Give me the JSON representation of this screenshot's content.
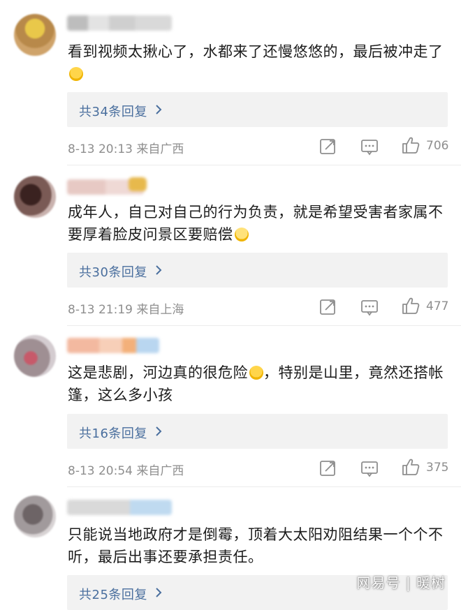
{
  "comments": [
    {
      "text": "看到视频太揪心了，水都来了还慢悠悠的，最后被冲走了",
      "replies": "共34条回复",
      "time": "8-13 20:13",
      "location": "来自广西",
      "likes": "706"
    },
    {
      "text": "成年人，自己对自己的行为负责，就是希望受害者家属不要厚着脸皮问景区要赔偿",
      "replies": "共30条回复",
      "time": "8-13 21:19",
      "location": "来自上海",
      "likes": "477"
    },
    {
      "text_part1": "这是悲剧，河边真的很危险",
      "text_part2": "，特别是山里，竟然还搭帐篷，这么多小孩",
      "replies": "共16条回复",
      "time": "8-13 20:54",
      "location": "来自广西",
      "likes": "375"
    },
    {
      "text": "只能说当地政府才是倒霉，顶着大太阳劝阻结果一个个不听，最后出事还要承担责任。",
      "replies": "共25条回复"
    }
  ],
  "icons": {
    "repost": "repost-icon",
    "comment": "comment-icon",
    "like": "thumbs-up-icon",
    "reply_chevron": "chevron-right-icon"
  },
  "colors": {
    "reply_link": "#4a6f9e",
    "meta_gray": "#8e8e8e",
    "reply_bg": "#f2f2f2"
  },
  "watermark": "网易号 | 暖树"
}
